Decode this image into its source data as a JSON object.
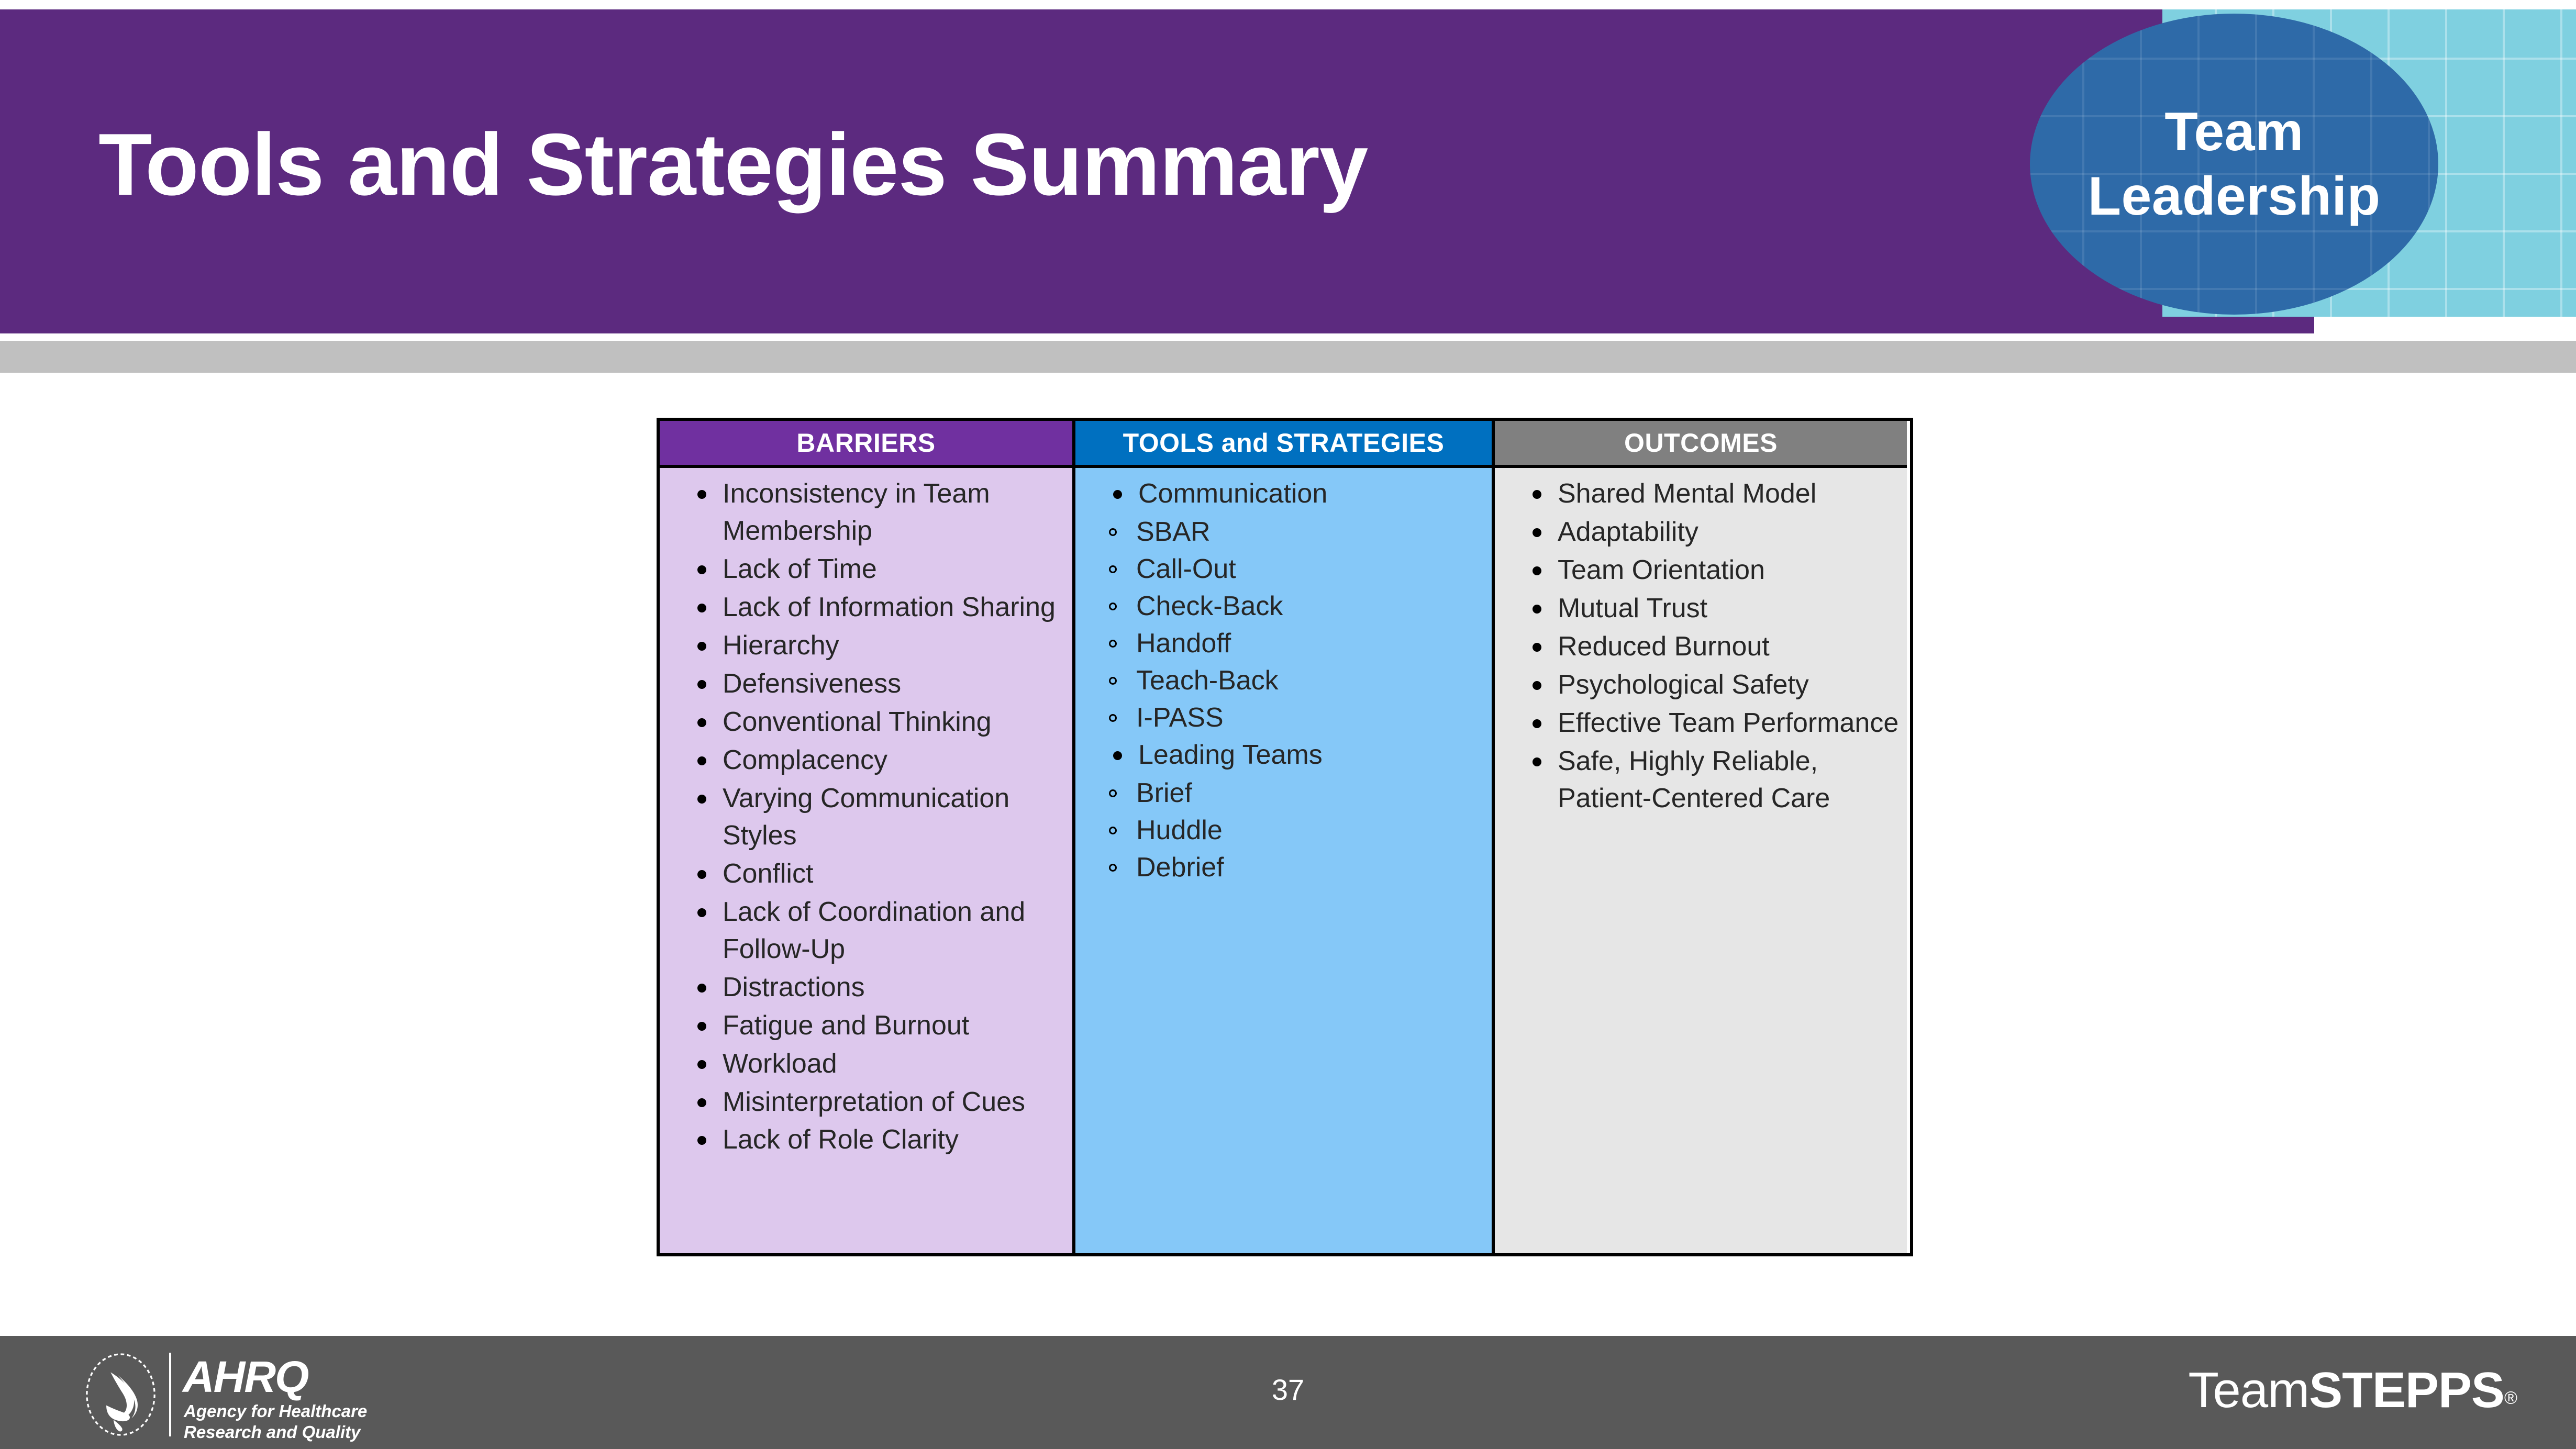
{
  "header": {
    "title": "Tools and Strategies Summary",
    "badge_label": "Team\nLeadership",
    "colors": {
      "banner_purple": "#5C2A7F",
      "badge_blue": "#2E6AA8",
      "grid_cyan": "#7FD0E0",
      "rule_gray": "#C0C0C0"
    }
  },
  "table": {
    "columns": [
      {
        "key": "barriers",
        "header": "BARRIERS",
        "header_color": "#7030A0",
        "body_color": "#DDC8ED",
        "items": [
          "Inconsistency in Team Membership",
          "Lack of Time",
          "Lack of Information Sharing",
          "Hierarchy",
          "Defensiveness",
          "Conventional Thinking",
          "Complacency",
          "Varying Communication Styles",
          "Conflict",
          "Lack of Coordination and Follow-Up",
          "Distractions",
          "Fatigue and Burnout",
          "Workload",
          "Misinterpretation of Cues",
          "Lack of Role Clarity"
        ]
      },
      {
        "key": "tools",
        "header": "TOOLS and STRATEGIES",
        "header_color": "#0070C0",
        "body_color": "#85C8F8",
        "groups": [
          {
            "label": "Communication",
            "sub_items": [
              "SBAR",
              "Call-Out",
              "Check-Back",
              "Handoff",
              "Teach-Back",
              "I-PASS"
            ]
          },
          {
            "label": "Leading Teams",
            "sub_items": [
              "Brief",
              "Huddle",
              "Debrief"
            ]
          }
        ]
      },
      {
        "key": "outcomes",
        "header": "OUTCOMES",
        "header_color": "#808080",
        "body_color": "#E6E6E6",
        "items": [
          "Shared Mental Model",
          "Adaptability",
          "Team Orientation",
          "Mutual Trust",
          "Reduced Burnout",
          "Psychological Safety",
          "Effective Team Performance",
          "Safe, Highly Reliable, Patient-Centered Care"
        ]
      }
    ]
  },
  "footer": {
    "page_number": "37",
    "ahrq": {
      "acronym": "AHRQ",
      "tagline": "Agency for Healthcare\nResearch and Quality"
    },
    "teamstepps": {
      "part_light": "Team",
      "part_bold": "STEPPS",
      "registered_mark": "®"
    },
    "background_color": "#595959"
  }
}
